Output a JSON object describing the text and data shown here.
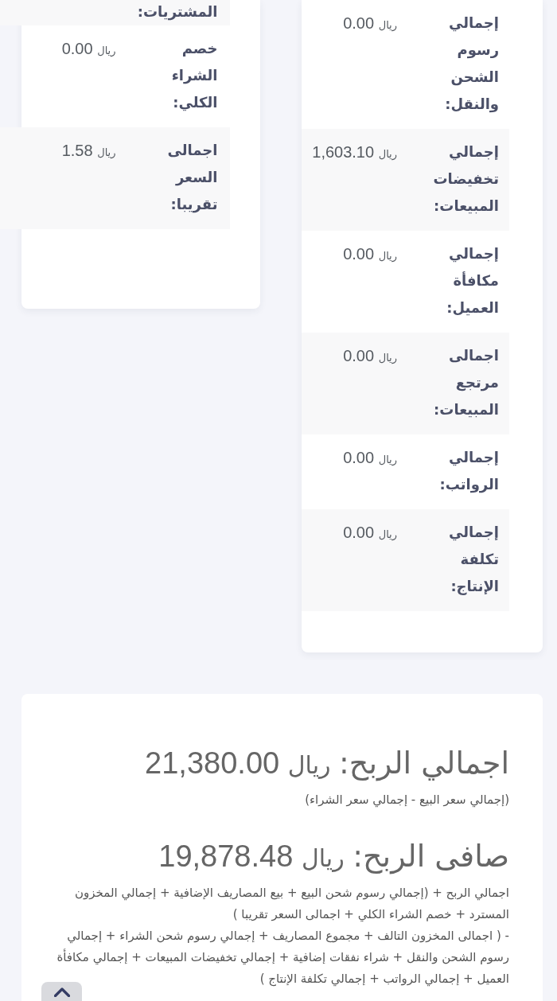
{
  "summary_cards": [
    {
      "rows": [
        {
          "label": "إجمالي رسوم الشحن والنقل:",
          "currency": "ريال",
          "amount": "0.00"
        },
        {
          "label": "إجمالي تخفيضات المبيعات:",
          "currency": "ريال",
          "amount": "1,603.10"
        },
        {
          "label": "إجمالي مكافأة العميل:",
          "currency": "ريال",
          "amount": "0.00"
        },
        {
          "label": "اجمالى مرتجع المبيعات:",
          "currency": "ريال",
          "amount": "0.00"
        },
        {
          "label": "إجمالي الرواتب:",
          "currency": "ريال",
          "amount": "0.00"
        },
        {
          "label": "إجمالي تكلفة الإنتاج:",
          "currency": "ريال",
          "amount": "0.00"
        }
      ]
    },
    {
      "rows": [
        {
          "label": "المشتريات:"
        },
        {
          "label": "خصم الشراء الكلي:",
          "currency": "ريال",
          "amount": "0.00"
        },
        {
          "label": "اجمالى السعر تقريبا:",
          "currency": "ريال",
          "amount": "1.58"
        }
      ]
    }
  ],
  "profit_card": {
    "gross": {
      "label": "اجمالي الربح:",
      "currency": "ريال",
      "amount": "21,380.00",
      "formula": "(إجمالي سعر البيع - إجمالي سعر الشراء)"
    },
    "net": {
      "label": "صافى الربح:",
      "currency": "ريال",
      "amount": "19,878.48",
      "formula_lines": [
        "اجمالي الربح + (إجمالي رسوم شحن البيع + بيع المصاريف الإضافية + إجمالي المخزون المسترد + خصم الشراء الكلي + اجمالى السعر تقريبا )",
        "- ( اجمالى المخزون التالف + مجموع المصاريف + إجمالي رسوم شحن الشراء + إجمالي رسوم الشحن والنقل + شراء نفقات إضافية + إجمالي تخفيضات المبيعات + إجمالي مكافأة العميل + إجمالي الرواتب + إجمالي تكلفة الإنتاج )"
      ]
    }
  }
}
